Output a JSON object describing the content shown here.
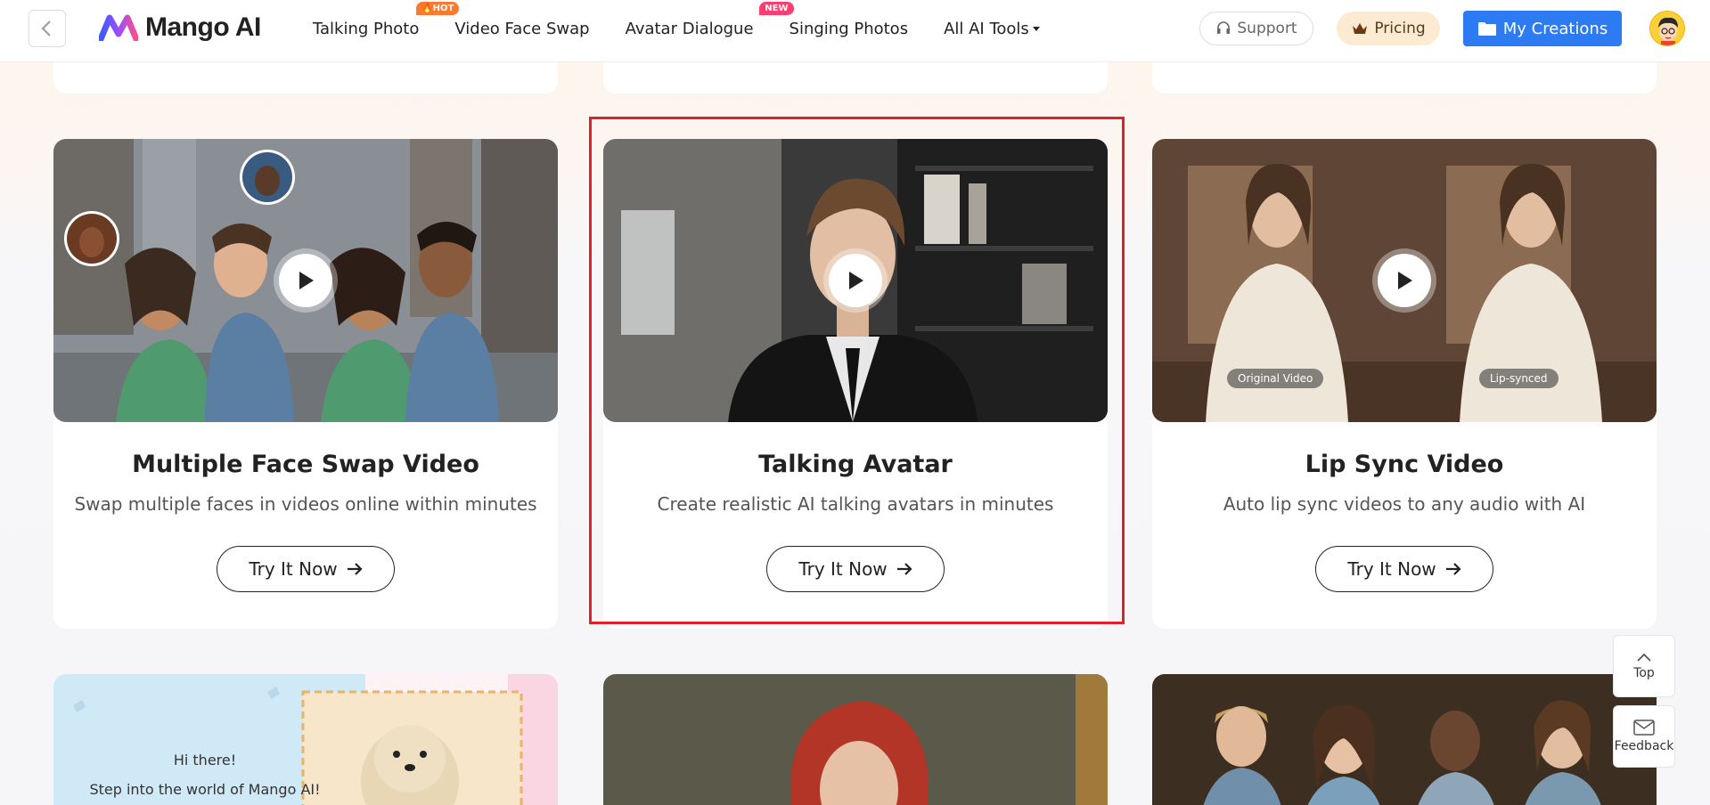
{
  "header": {
    "logo_text": "Mango AI",
    "nav": [
      {
        "label": "Talking Photo",
        "badge": "HOT"
      },
      {
        "label": "Video Face Swap",
        "badge": ""
      },
      {
        "label": "Avatar Dialogue",
        "badge": "NEW"
      },
      {
        "label": "Singing Photos",
        "badge": ""
      },
      {
        "label": "All AI Tools",
        "badge": ""
      }
    ],
    "support_label": "Support",
    "pricing_label": "Pricing",
    "creations_label": "My Creations"
  },
  "cards": [
    {
      "title": "Multiple Face Swap Video",
      "description": "Swap multiple faces in videos online within minutes",
      "cta": "Try It Now"
    },
    {
      "title": "Talking Avatar",
      "description": "Create realistic AI talking avatars in minutes",
      "cta": "Try It Now"
    },
    {
      "title": "Lip Sync Video",
      "description": "Auto lip sync videos to any audio with AI",
      "cta": "Try It Now",
      "tags": [
        "Original Video",
        "Lip-synced"
      ]
    }
  ],
  "bottom_card_1": {
    "line1": "Hi there!",
    "line2": "Step into the world of Mango AI!"
  },
  "float": {
    "top_label": "Top",
    "feedback_label": "Feedback"
  },
  "colors": {
    "accent_blue": "#2c7bf2",
    "highlight_red": "#e0212b",
    "hot_badge": "#ff7a2f",
    "new_badge": "#ff3d6e"
  }
}
